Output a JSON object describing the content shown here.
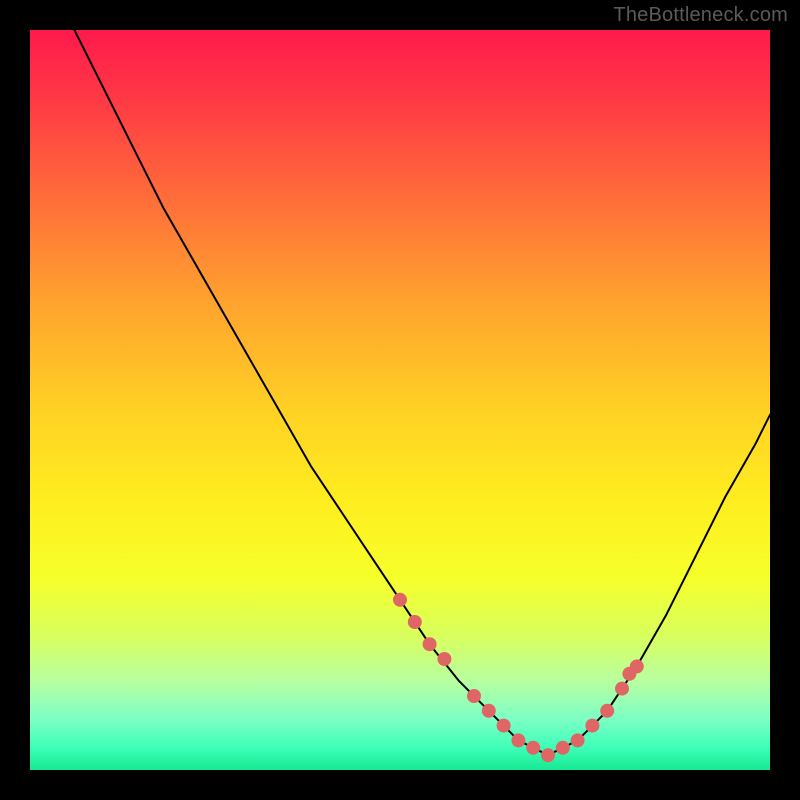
{
  "watermark": "TheBottleneck.com",
  "chart_data": {
    "type": "line",
    "title": "",
    "xlabel": "",
    "ylabel": "",
    "xlim": [
      0,
      100
    ],
    "ylim": [
      0,
      100
    ],
    "grid": false,
    "series": [
      {
        "name": "curve",
        "x": [
          6,
          10,
          14,
          18,
          22,
          26,
          30,
          34,
          38,
          42,
          46,
          50,
          54,
          58,
          62,
          66,
          70,
          74,
          78,
          82,
          86,
          90,
          94,
          98,
          100
        ],
        "values": [
          100,
          92,
          84,
          76,
          69,
          62,
          55,
          48,
          41,
          35,
          29,
          23,
          17,
          12,
          8,
          4,
          2,
          4,
          8,
          14,
          21,
          29,
          37,
          44,
          48
        ]
      }
    ],
    "markers": {
      "name": "highlight-dots",
      "color": "#e06666",
      "radius": 7,
      "x": [
        50,
        52,
        54,
        56,
        60,
        62,
        64,
        66,
        68,
        70,
        72,
        74,
        76,
        78,
        80,
        81,
        82
      ],
      "values": [
        23,
        20,
        17,
        15,
        10,
        8,
        6,
        4,
        3,
        2,
        3,
        4,
        6,
        8,
        11,
        13,
        14
      ]
    },
    "gradient_colors": {
      "top": "#ff1a4c",
      "bottom": "#17e892"
    }
  }
}
